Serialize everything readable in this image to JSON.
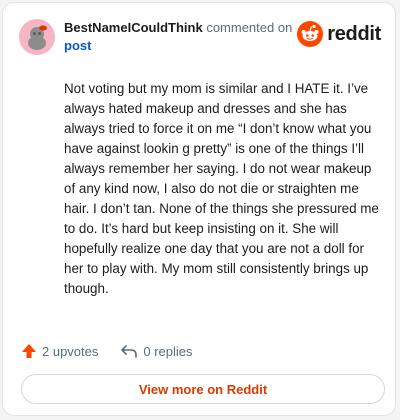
{
  "header": {
    "author": "BestNameICouldThink",
    "action": "commented on",
    "target": "post",
    "brand": "reddit"
  },
  "comment": {
    "text": "Not voting but my mom is similar and I HATE it. I’ve always hated makeup and dresses and she has always tried to force it on me “I don’t know what you have against lookin g pretty” is one of the things I’ll always remember her saying. I do not wear makeup of any kind now, I also do not die or straighten me hair. I don’t tan. None of the things she pressured me to do. It’s hard but keep insisting on it. She will hopefully realize one day that you are not a doll for her to play with. My mom still consistently brings up though."
  },
  "actions": {
    "upvotes": "2 upvotes",
    "replies": "0 replies"
  },
  "footer": {
    "view_more": "View more on Reddit"
  },
  "colors": {
    "accent": "#ff4500",
    "link": "#0a58ca",
    "avatar_bg": "#f5b5c5"
  }
}
